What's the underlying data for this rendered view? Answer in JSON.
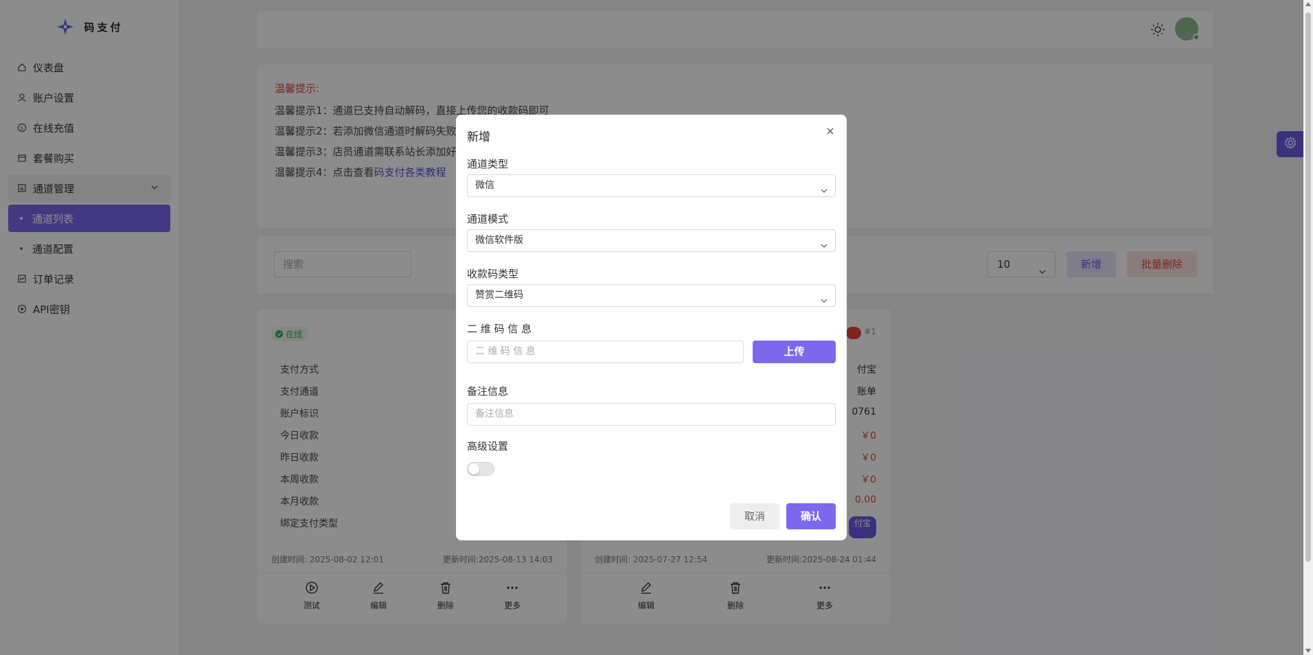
{
  "app": {
    "name": "码支付"
  },
  "sidebar": {
    "items": [
      {
        "label": "仪表盘",
        "icon": "home-icon"
      },
      {
        "label": "账户设置",
        "icon": "user-icon"
      },
      {
        "label": "在线充值",
        "icon": "coin-icon"
      },
      {
        "label": "套餐购买",
        "icon": "package-icon"
      },
      {
        "label": "通道管理",
        "icon": "chart-icon"
      },
      {
        "label": "通道列表"
      },
      {
        "label": "通道配置"
      },
      {
        "label": "订单记录",
        "icon": "order-icon"
      },
      {
        "label": "API密钥",
        "icon": "key-icon"
      }
    ]
  },
  "tips": {
    "title": "温馨提示:",
    "line1": "温馨提示1：通道已支持自动解码，直接上传您的收款码即可",
    "line2": "温馨提示2：若添加微信通道时解码失败",
    "line3": "温馨提示3：店员通道需联系站长添加好",
    "line4_prefix": "温馨提示4：点击查看",
    "line4_link": "码支付各类教程"
  },
  "toolbar": {
    "search_placeholder": "搜索",
    "page_size": "10",
    "add_label": "新增",
    "batch_delete_label": "批量删除"
  },
  "card1": {
    "status": "在线",
    "rows": [
      {
        "label": "支付方式",
        "value": ""
      },
      {
        "label": "支付通道",
        "value": ""
      },
      {
        "label": "账户标识",
        "value": ""
      },
      {
        "label": "今日收款",
        "value": ""
      },
      {
        "label": "昨日收款",
        "value": ""
      },
      {
        "label": "本周收款",
        "value": ""
      },
      {
        "label": "本月收款",
        "value": ""
      },
      {
        "label": "绑定支付类型",
        "value": ""
      }
    ],
    "created": "创建时间: 2025-08-02 12:01",
    "updated": "更新时间:2025-08-13 14:03",
    "actions": [
      "测试",
      "编辑",
      "删除",
      "更多"
    ]
  },
  "card2": {
    "num": "#1",
    "rows": [
      {
        "value": "付宝"
      },
      {
        "value": "账单"
      },
      {
        "value": "0761"
      },
      {
        "value": "￥0"
      },
      {
        "value": "￥0"
      },
      {
        "value": "￥0"
      },
      {
        "value": "0.00"
      },
      {
        "value": "付宝"
      }
    ],
    "created": "创建时间: 2025-07-27 12:54",
    "updated": "更新时间:2025-08-24 01:44",
    "actions": [
      "编辑",
      "删除",
      "更多"
    ]
  },
  "modal": {
    "title": "新增",
    "channel_type_label": "通道类型",
    "channel_type_value": "微信",
    "channel_mode_label": "通道模式",
    "channel_mode_value": "微信软件版",
    "qr_type_label": "收款码类型",
    "qr_type_value": "赞赏二维码",
    "qr_info_label": "二 维 码 信 息",
    "qr_info_placeholder": "二 维 码 信 息",
    "upload_label": "上传",
    "remark_label": "备注信息",
    "remark_placeholder": "备注信息",
    "advanced_label": "高级设置",
    "cancel_label": "取消",
    "confirm_label": "确认"
  },
  "colors": {
    "accent": "#7b68ee",
    "danger": "#e0453a",
    "success": "#2fae5a"
  }
}
